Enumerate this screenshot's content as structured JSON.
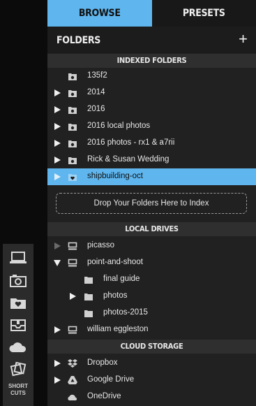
{
  "tabs": {
    "browse": "BROWSE",
    "presets": "PRESETS"
  },
  "folders_header": {
    "title": "FOLDERS",
    "add": "+"
  },
  "sections": {
    "indexed": "INDEXED FOLDERS",
    "local": "LOCAL DRIVES",
    "cloud": "CLOUD STORAGE"
  },
  "indexed_folders": [
    {
      "label": "135f2",
      "expandable": false
    },
    {
      "label": "2014",
      "expandable": true
    },
    {
      "label": "2016",
      "expandable": true
    },
    {
      "label": "2016 local photos",
      "expandable": true
    },
    {
      "label": "2016 photos - rx1 & a7rii",
      "expandable": true
    },
    {
      "label": "Rick & Susan Wedding",
      "expandable": true
    },
    {
      "label": "shipbuilding-oct",
      "expandable": true,
      "selected": true
    }
  ],
  "dropzone": "Drop Your Folders Here to Index",
  "local_drives": [
    {
      "label": "picasso"
    },
    {
      "label": "point-and-shoot"
    },
    {
      "label": "final guide"
    },
    {
      "label": "photos"
    },
    {
      "label": "photos-2015"
    },
    {
      "label": "william eggleston"
    }
  ],
  "cloud_storage": [
    {
      "label": "Dropbox",
      "icon": "dropbox-icon"
    },
    {
      "label": "Google Drive",
      "icon": "google-drive-icon"
    },
    {
      "label": "OneDrive",
      "icon": "onedrive-icon"
    }
  ],
  "shortcuts": {
    "label_line1": "SHORT",
    "label_line2": "CUTS",
    "icons": [
      "laptop-icon",
      "camera-icon",
      "heart-folder-icon",
      "inbox-icon",
      "cloud-icon",
      "rotate-photos-icon"
    ]
  },
  "colors": {
    "accent": "#5fb6ef",
    "panel": "#212121",
    "section": "#2f2f2f"
  }
}
